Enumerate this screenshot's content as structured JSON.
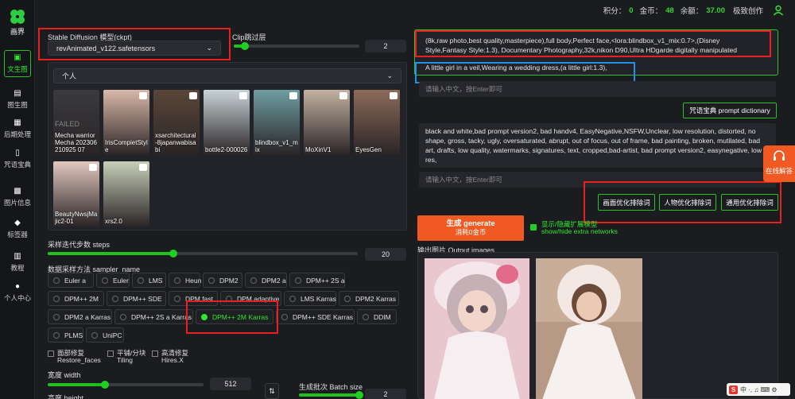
{
  "app": {
    "brand": "画界"
  },
  "sidebar": {
    "items": [
      {
        "label": "文生图",
        "icon": "image-icon",
        "glyph": "▣"
      },
      {
        "label": "图生图",
        "icon": "images-icon",
        "glyph": "▤"
      },
      {
        "label": "后期处理",
        "icon": "layers-icon",
        "glyph": "▦"
      },
      {
        "label": "咒语宝典",
        "icon": "phone-book-icon",
        "glyph": "▯"
      },
      {
        "label": "图片信息",
        "icon": "picture-info-icon",
        "glyph": "▩"
      },
      {
        "label": "标签器",
        "icon": "tag-icon",
        "glyph": "◆"
      },
      {
        "label": "教程",
        "icon": "book-icon",
        "glyph": "▥"
      },
      {
        "label": "个人中心",
        "icon": "user-icon",
        "glyph": "●"
      }
    ]
  },
  "topbar": {
    "points_label": "积分：",
    "points": "0",
    "coins_label": "金币：",
    "coins": "48",
    "balance_label": "余额：",
    "balance": "37.00",
    "creator": "极致创作"
  },
  "left": {
    "model_label": "Stable Diffusion 模型(ckpt)",
    "model_value": "revAnimated_v122.safetensors",
    "clip_label": "Clip跳过层",
    "clip_value": "2",
    "lora_group": "个人",
    "thumbs": [
      {
        "caption": "Mecha warrior Mecha 202306210925 07",
        "failed": "FAILED"
      },
      {
        "caption": "IrisCompietStyle"
      },
      {
        "caption": "xsarchitectural-8japanwabisabi"
      },
      {
        "caption": "bottle2-000026"
      },
      {
        "caption": "blindbox_v1_mix"
      },
      {
        "caption": "MoXinV1"
      },
      {
        "caption": "EyesGen"
      },
      {
        "caption": "BeautyNwsjMajic2-01"
      },
      {
        "caption": "xrs2.0"
      }
    ],
    "steps_label": "采样迭代步数 steps",
    "steps_value": "20",
    "steps_fraction": 0.2,
    "sampler_label": "数据采样方法 sampler_name",
    "samplers": [
      "Euler a",
      "Euler",
      "LMS",
      "Heun",
      "DPM2",
      "DPM2 a",
      "DPM++ 2S a",
      "DPM++ 2M",
      "DPM++ SDE",
      "DPM fast",
      "DPM adaptive",
      "LMS Karras",
      "DPM2 Karras",
      "DPM2 a Karras",
      "DPM++ 2S a Karras",
      "DPM++ 2M Karras",
      "DPM++ SDE Karras",
      "DDIM",
      "PLMS",
      "UniPC"
    ],
    "selected_sampler": "DPM++ 2M Karras",
    "restore_faces": "面部修复\nRestore_faces",
    "tiling": "平铺/分块\nTiling",
    "hires": "高清修复\nHires.X",
    "width_label": "宽度 width",
    "width_value": "512",
    "height_label": "高度 height",
    "batch_label": "生成批次 Batch size",
    "batch_value": "2"
  },
  "right": {
    "positive_prompt": "(8k,raw photo,best quality,masterpiece),full body,Perfect face,<lora:blindbox_v1_mix:0.7>,(Disney Style,Fantasy Style:1.3), Documentary Photography,32k,nikon D90,Ultra HDgarde digitally manipulated photograph,",
    "positive_prompt_2": "A little girl in a veil,Wearing a wedding dress,(a little girl:1.3),",
    "input_placeholder": "请输入中文，按Enter即可",
    "dictionary_button": "咒语宝典 prompt dictionary",
    "negative_prompt": "black and white,bad prompt version2, bad handv4, EasyNegative,NSFW,Unclear, low resolution, distorted, no shape, gross, tacky, ugly, oversaturated, abrupt, out of focus, out of frame, bad painting, broken, mutilated, bad art, drafts, low quality, watermarks, signatures, text, cropped,bad-artist, bad prompt version2, easynegative, low res,",
    "neg_input_placeholder": "请输入中文，按Enter即可",
    "opt_buttons": [
      "画面优化排除词",
      "人物优化排除词",
      "通用优化排除词"
    ],
    "generate_label": "生成 generate",
    "generate_cost": "消耗0金币",
    "extra_networks": "显示/隐藏扩展模型\nshow/hide extra networks",
    "output_label": "输出图片 Output images"
  },
  "help": {
    "label": "在线解答",
    "icon": "headset-icon"
  },
  "tray": {
    "logo": "S",
    "items": "中 ·, ♫ ⌨ ⚙"
  }
}
